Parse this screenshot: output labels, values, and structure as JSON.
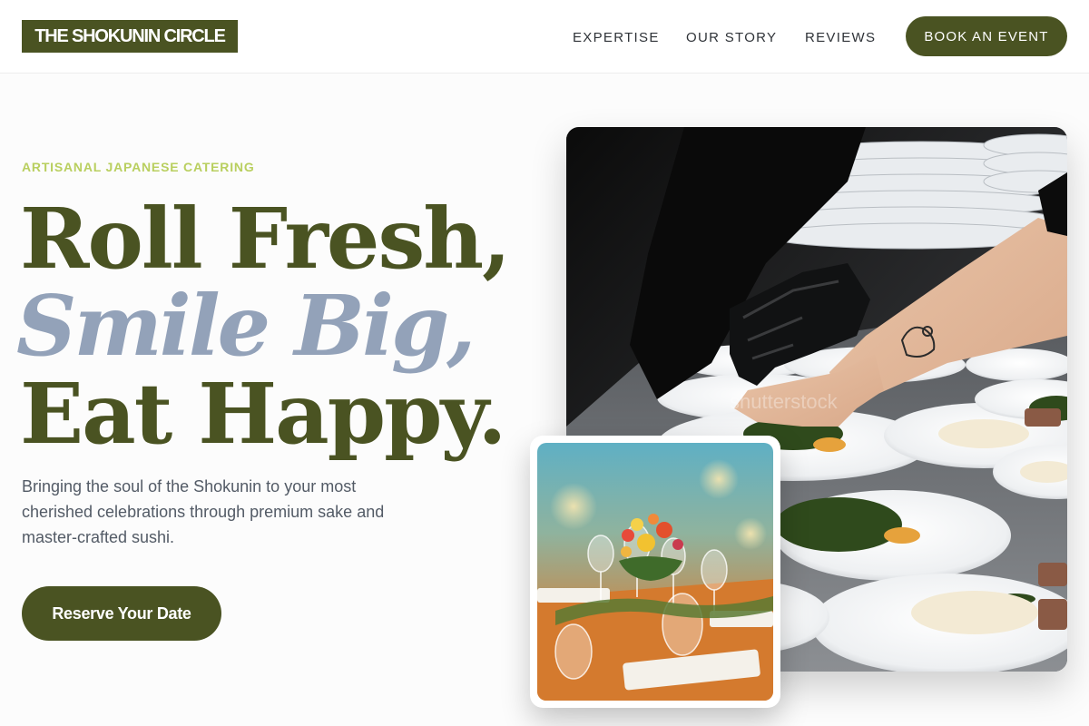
{
  "brand": {
    "name": "THE SHOKUNIN CIRCLE"
  },
  "nav": {
    "items": [
      {
        "label": "EXPERTISE"
      },
      {
        "label": "OUR STORY"
      },
      {
        "label": "REVIEWS"
      }
    ],
    "cta_label": "BOOK AN EVENT"
  },
  "hero": {
    "eyebrow": "ARTISANAL JAPANESE CATERING",
    "headline": {
      "line1": "Roll Fresh,",
      "line2": "Smile Big,",
      "line3": "Eat Happy."
    },
    "subcopy": "Bringing the soul of the Shokunin to your most cherished celebrations through premium sake and master-crafted sushi.",
    "cta_label": "Reserve Your Date"
  },
  "images": {
    "main": {
      "subject": "chef-plating-dishes-photo"
    },
    "inset": {
      "subject": "table-setting-flowers-photo"
    }
  },
  "colors": {
    "brand_olive": "#4a5322",
    "accent_lime": "#b9cf5f",
    "accent_slate_blue": "#93a2b9",
    "body_text": "#535b66",
    "background": "#fcfcfc"
  }
}
